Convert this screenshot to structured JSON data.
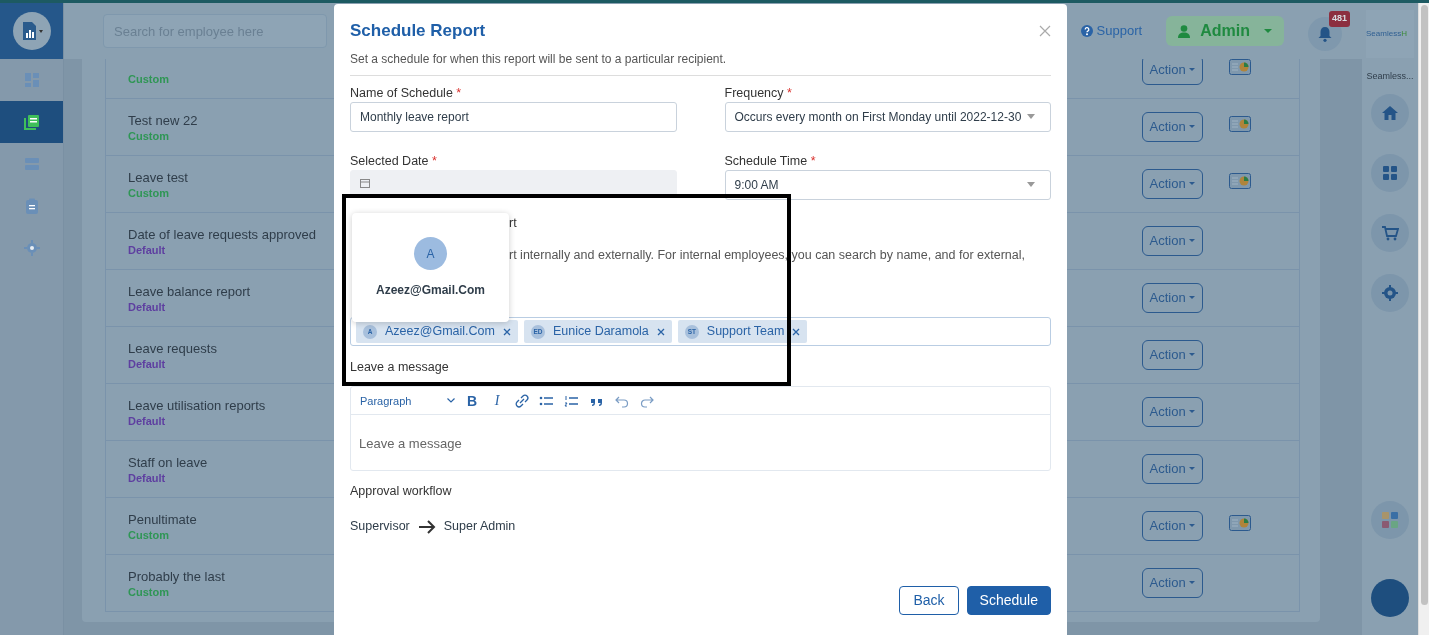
{
  "sidebar": {
    "items": [
      {
        "selected": false
      },
      {
        "selected": true
      },
      {
        "selected": false
      },
      {
        "selected": false
      },
      {
        "selected": false
      }
    ]
  },
  "header": {
    "search": {
      "placeholder": "Search for employee here"
    },
    "support": "Support",
    "user": "Admin",
    "notifications": "481"
  },
  "reports": [
    {
      "type": "Custom",
      "color": "#2f9655",
      "action": "Action",
      "chart": true
    },
    {
      "name": "Test new 22",
      "type": "Custom",
      "color": "#2f9655",
      "action": "Action",
      "chart": true
    },
    {
      "name": "Leave test",
      "type": "Custom",
      "color": "#2f9655",
      "action": "Action",
      "chart": true
    },
    {
      "name": "Date of leave requests approved",
      "type": "Default",
      "color": "#5e3fa0",
      "action": "Action",
      "chart": false
    },
    {
      "name": "Leave balance report",
      "type": "Default",
      "color": "#5e3fa0",
      "action": "Action",
      "chart": false
    },
    {
      "name": "Leave requests",
      "type": "Default",
      "color": "#5e3fa0",
      "action": "Action",
      "chart": false
    },
    {
      "name": "Leave utilisation reports",
      "type": "Default",
      "color": "#5e3fa0",
      "action": "Action",
      "chart": false
    },
    {
      "name": "Staff on leave",
      "type": "Default",
      "color": "#5e3fa0",
      "action": "Action",
      "chart": false
    },
    {
      "name": "Penultimate",
      "type": "Custom",
      "color": "#2f9655",
      "action": "Action",
      "chart": true
    },
    {
      "name": "Probably the last",
      "type": "Custom",
      "color": "#2f9655",
      "action": "Action",
      "chart": false
    }
  ],
  "right_panel": {
    "logo": "Seamless",
    "logo_accent": "H",
    "company": "Seamless..."
  },
  "modal": {
    "title": "Schedule Report",
    "subtitle": "Set a schedule for when this report will be sent to a particular recipient.",
    "fields": [
      {
        "label": "Name of Schedule",
        "required_mark": "*",
        "kind": "text",
        "value": "Monthly leave report"
      },
      {
        "label": "Frequency",
        "required_mark": "*",
        "kind": "select",
        "value": "Occurs every month on First Monday until 2022-12-30"
      },
      {
        "label": "Selected Date",
        "required_mark": "*",
        "kind": "date"
      },
      {
        "label": "Schedule Time",
        "required_mark": "*",
        "kind": "select",
        "value": "9:00 AM"
      }
    ],
    "recipients_label": "rt",
    "recipients_help": "rt internally and externally. For internal employees, you can search by name, and for external,",
    "recipients": [
      {
        "initials": "A",
        "name": "Azeez@Gmail.Com"
      },
      {
        "initials": "ED",
        "name": "Eunice Daramola"
      },
      {
        "initials": "ST",
        "name": "Support Team"
      }
    ],
    "popup": {
      "initial": "A",
      "name": "Azeez@Gmail.Com"
    },
    "message_label": "Leave a message",
    "editor": {
      "format": "Paragraph",
      "tools": [
        {
          "kind": "bold",
          "glyph": "B"
        },
        {
          "kind": "italic",
          "glyph": "I"
        },
        {
          "kind": "link"
        },
        {
          "kind": "bullets"
        },
        {
          "kind": "numbers"
        },
        {
          "kind": "quote"
        },
        {
          "kind": "undo"
        },
        {
          "kind": "redo"
        }
      ],
      "placeholder": "Leave a message"
    },
    "workflow_label": "Approval workflow",
    "workflow": [
      "Supervisor",
      "Super Admin"
    ],
    "buttons": [
      {
        "label": "Back",
        "kind": "secondary"
      },
      {
        "label": "Schedule",
        "kind": "primary"
      }
    ]
  }
}
